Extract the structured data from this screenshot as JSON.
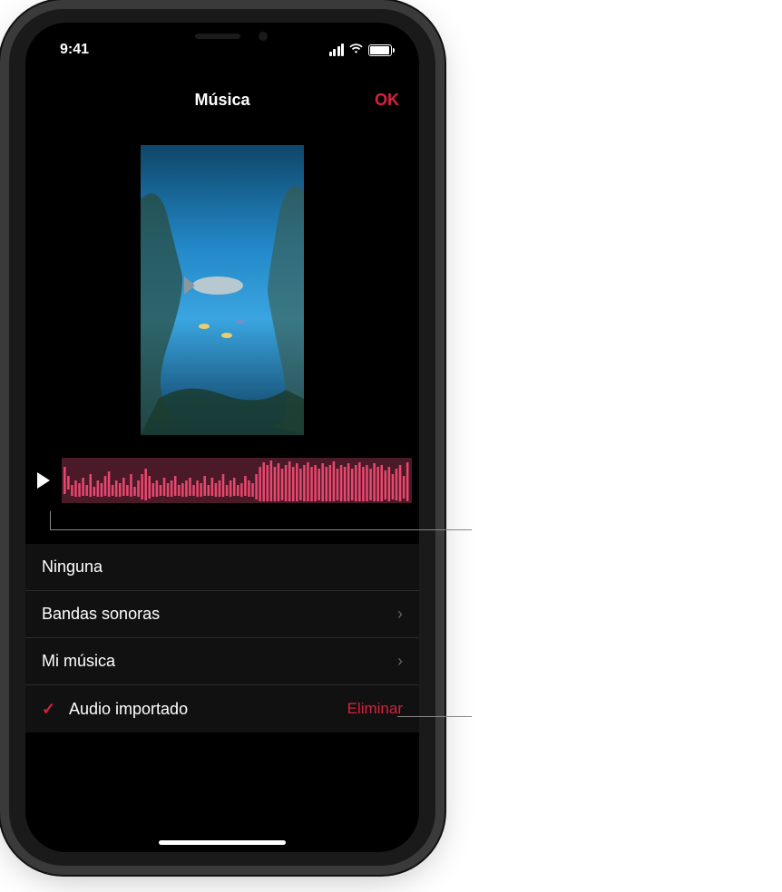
{
  "status": {
    "time": "9:41"
  },
  "nav": {
    "title": "Música",
    "confirm": "OK"
  },
  "options": {
    "none": "Ninguna",
    "soundtracks": "Bandas sonoras",
    "my_music": "Mi música",
    "imported": "Audio importado",
    "delete": "Eliminar"
  },
  "colors": {
    "accent": "#d7223c"
  }
}
